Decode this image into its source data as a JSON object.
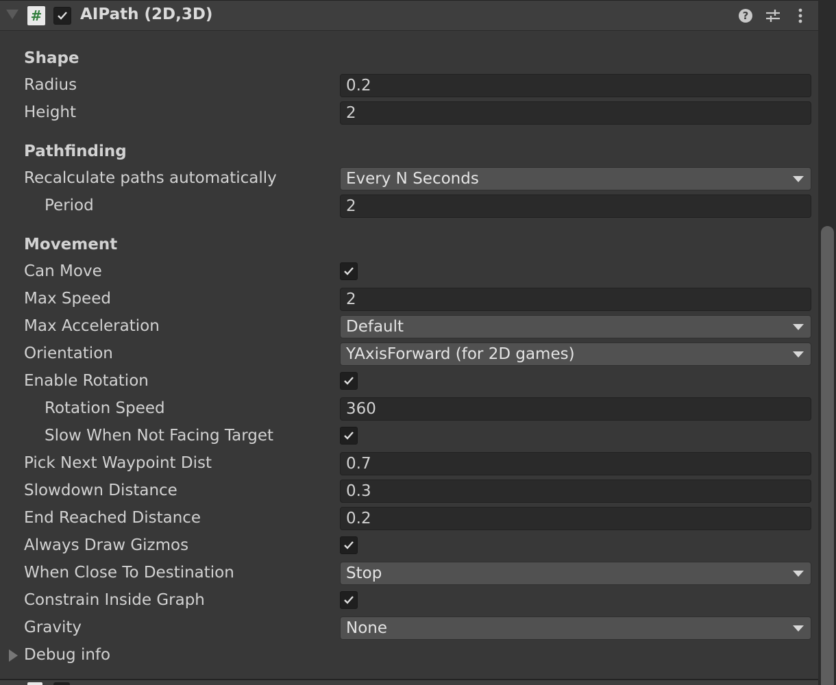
{
  "header": {
    "title": "AIPath (2D,3D)",
    "script_icon_glyph": "#",
    "enabled": true,
    "icons": [
      "help-icon",
      "presets-icon",
      "menu-icon"
    ]
  },
  "sections": {
    "shape": "Shape",
    "pathfinding": "Pathfinding",
    "movement": "Movement"
  },
  "fields": {
    "radius": {
      "label": "Radius",
      "value": "0.2"
    },
    "height": {
      "label": "Height",
      "value": "2"
    },
    "recalculate": {
      "label": "Recalculate paths automatically",
      "value": "Every N Seconds"
    },
    "period": {
      "label": "Period",
      "value": "2"
    },
    "can_move": {
      "label": "Can Move",
      "checked": true
    },
    "max_speed": {
      "label": "Max Speed",
      "value": "2"
    },
    "max_acceleration": {
      "label": "Max Acceleration",
      "value": "Default"
    },
    "orientation": {
      "label": "Orientation",
      "value": "YAxisForward (for 2D games)"
    },
    "enable_rotation": {
      "label": "Enable Rotation",
      "checked": true
    },
    "rotation_speed": {
      "label": "Rotation Speed",
      "value": "360"
    },
    "slow_when_not_facing": {
      "label": "Slow When Not Facing Target",
      "checked": true
    },
    "pick_next_waypoint": {
      "label": "Pick Next Waypoint Dist",
      "value": "0.7"
    },
    "slowdown_distance": {
      "label": "Slowdown Distance",
      "value": "0.3"
    },
    "end_reached_distance": {
      "label": "End Reached Distance",
      "value": "0.2"
    },
    "always_draw_gizmos": {
      "label": "Always Draw Gizmos",
      "checked": true
    },
    "when_close": {
      "label": "When Close To Destination",
      "value": "Stop"
    },
    "constrain_inside_graph": {
      "label": "Constrain Inside Graph",
      "checked": true
    },
    "gravity": {
      "label": "Gravity",
      "value": "None"
    }
  },
  "debug_info": {
    "label": "Debug info",
    "expanded": false
  },
  "colors": {
    "background": "#383838",
    "header": "#3e3e3e",
    "field": "#2a2a2a",
    "dropdown": "#515151",
    "text": "#d2d2d2",
    "script_icon": "#2f7d3a"
  }
}
